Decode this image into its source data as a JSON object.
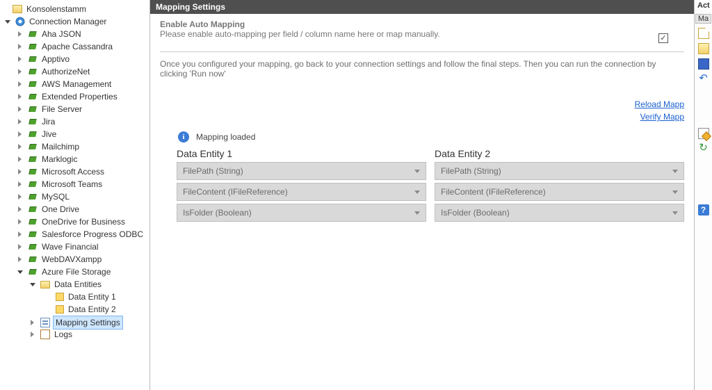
{
  "tree": {
    "root_label": "Konsolenstamm",
    "connection_manager_label": "Connection Manager",
    "connections": [
      "Aha JSON",
      "Apache Cassandra",
      "Apptivo",
      "AuthorizeNet",
      "AWS Management",
      "Extended Properties",
      "File Server",
      "Jira",
      "Jive",
      "Mailchimp",
      "Marklogic",
      "Microsoft Access",
      "Microsoft Teams",
      "MySQL",
      "One Drive",
      "OneDrive for Business",
      "Salesforce Progress ODBC",
      "Wave Financial",
      "WebDAVXampp"
    ],
    "expanded_connection": "Azure File Storage",
    "data_entities_label": "Data Entities",
    "entities": [
      "Data Entity 1",
      "Data Entity 2"
    ],
    "mapping_settings_label": "Mapping Settings",
    "logs_label": "Logs"
  },
  "header": {
    "title": "Mapping Settings"
  },
  "enable": {
    "title": "Enable Auto Mapping",
    "subtitle": "Please enable auto-mapping per field / column name here or map manually.",
    "checked_glyph": "✓"
  },
  "instruction": "Once you configured your mapping, go back to your connection settings and follow the final steps. Then you can run the connection by clicking 'Run now'",
  "links": {
    "reload": "Reload Mapp",
    "verify": "Verify Mapp"
  },
  "loaded": {
    "info_glyph": "i",
    "text": "Mapping loaded"
  },
  "entity1": {
    "header": "Data Entity 1",
    "fields": [
      "FilePath (String)",
      "FileContent (IFileReference)",
      "IsFolder (Boolean)"
    ]
  },
  "entity2": {
    "header": "Data Entity 2",
    "fields": [
      "FilePath (String)",
      "FileContent (IFileReference)",
      "IsFolder (Boolean)"
    ]
  },
  "rail": {
    "header": "Act",
    "tab": "Ma",
    "undo_glyph": "↶",
    "refresh_glyph": "↻",
    "help_glyph": "?"
  }
}
